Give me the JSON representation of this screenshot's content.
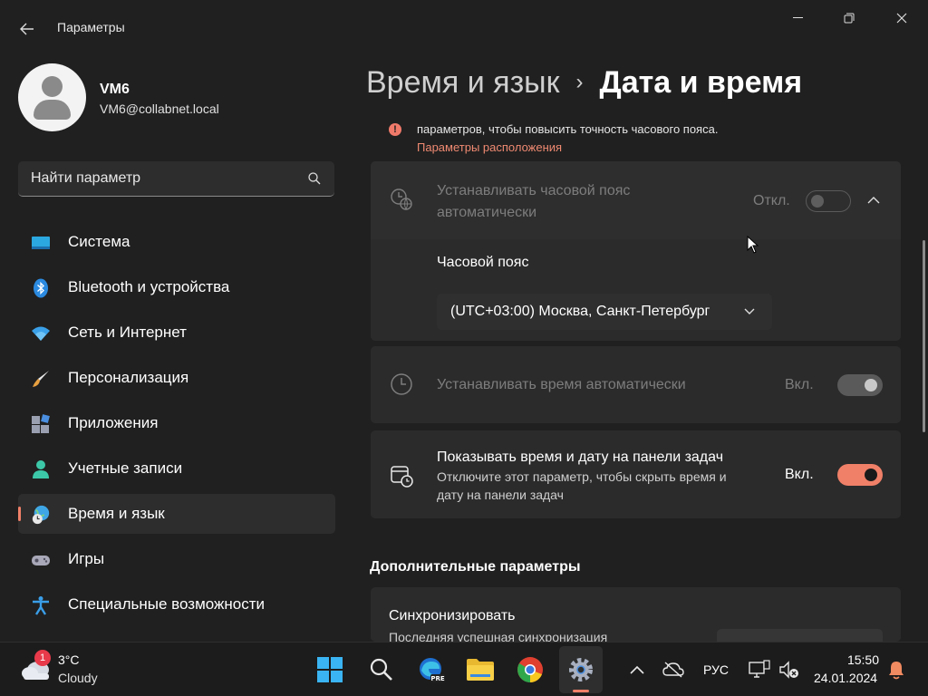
{
  "window": {
    "title": "Параметры",
    "controls": {
      "minimize": "minimize-icon",
      "maximize": "restore-icon",
      "close": "close-icon"
    }
  },
  "user": {
    "name": "VM6",
    "email": "VM6@collabnet.local"
  },
  "search": {
    "placeholder": "Найти параметр"
  },
  "sidebar": {
    "items": [
      {
        "label": "Система",
        "icon": "system-icon"
      },
      {
        "label": "Bluetooth и устройства",
        "icon": "bluetooth-icon"
      },
      {
        "label": "Сеть и Интернет",
        "icon": "wifi-icon"
      },
      {
        "label": "Персонализация",
        "icon": "brush-icon"
      },
      {
        "label": "Приложения",
        "icon": "apps-icon"
      },
      {
        "label": "Учетные записи",
        "icon": "account-icon"
      },
      {
        "label": "Время и язык",
        "icon": "globe-clock-icon",
        "active": true
      },
      {
        "label": "Игры",
        "icon": "gamepad-icon"
      },
      {
        "label": "Специальные возможности",
        "icon": "accessibility-icon"
      }
    ]
  },
  "breadcrumb": {
    "parent": "Время и язык",
    "separator": "›",
    "current": "Дата и время"
  },
  "location_notice": {
    "text": "параметров, чтобы повысить точность часового пояса.",
    "link": "Параметры расположения",
    "icon": "!"
  },
  "auto_timezone": {
    "title_line1": "Устанавливать часовой пояс",
    "title_line2": "автоматически",
    "state_label": "Откл.",
    "on": false,
    "enabled": false
  },
  "timezone": {
    "label": "Часовой пояс",
    "value": "(UTC+03:00) Москва, Санкт-Петербург"
  },
  "auto_time": {
    "title": "Устанавливать время автоматически",
    "state_label": "Вкл.",
    "on": true,
    "enabled": false
  },
  "taskbar_time": {
    "title": "Показывать время и дату на панели задач",
    "desc_line1": "Отключите этот параметр, чтобы скрыть время и",
    "desc_line2": "дату на панели задач",
    "state_label": "Вкл.",
    "on": true
  },
  "additional": {
    "heading": "Дополнительные параметры",
    "sync_title": "Синхронизировать",
    "sync_desc": "Последняя успешная синхронизация"
  },
  "taskbar": {
    "weather_temp": "3°C",
    "weather_desc": "Cloudy",
    "weather_badge": "1",
    "language": "РУС",
    "time": "15:50",
    "date": "24.01.2024"
  },
  "colors": {
    "accent": "#f08068",
    "background": "#202020",
    "card": "#2b2b2b"
  }
}
